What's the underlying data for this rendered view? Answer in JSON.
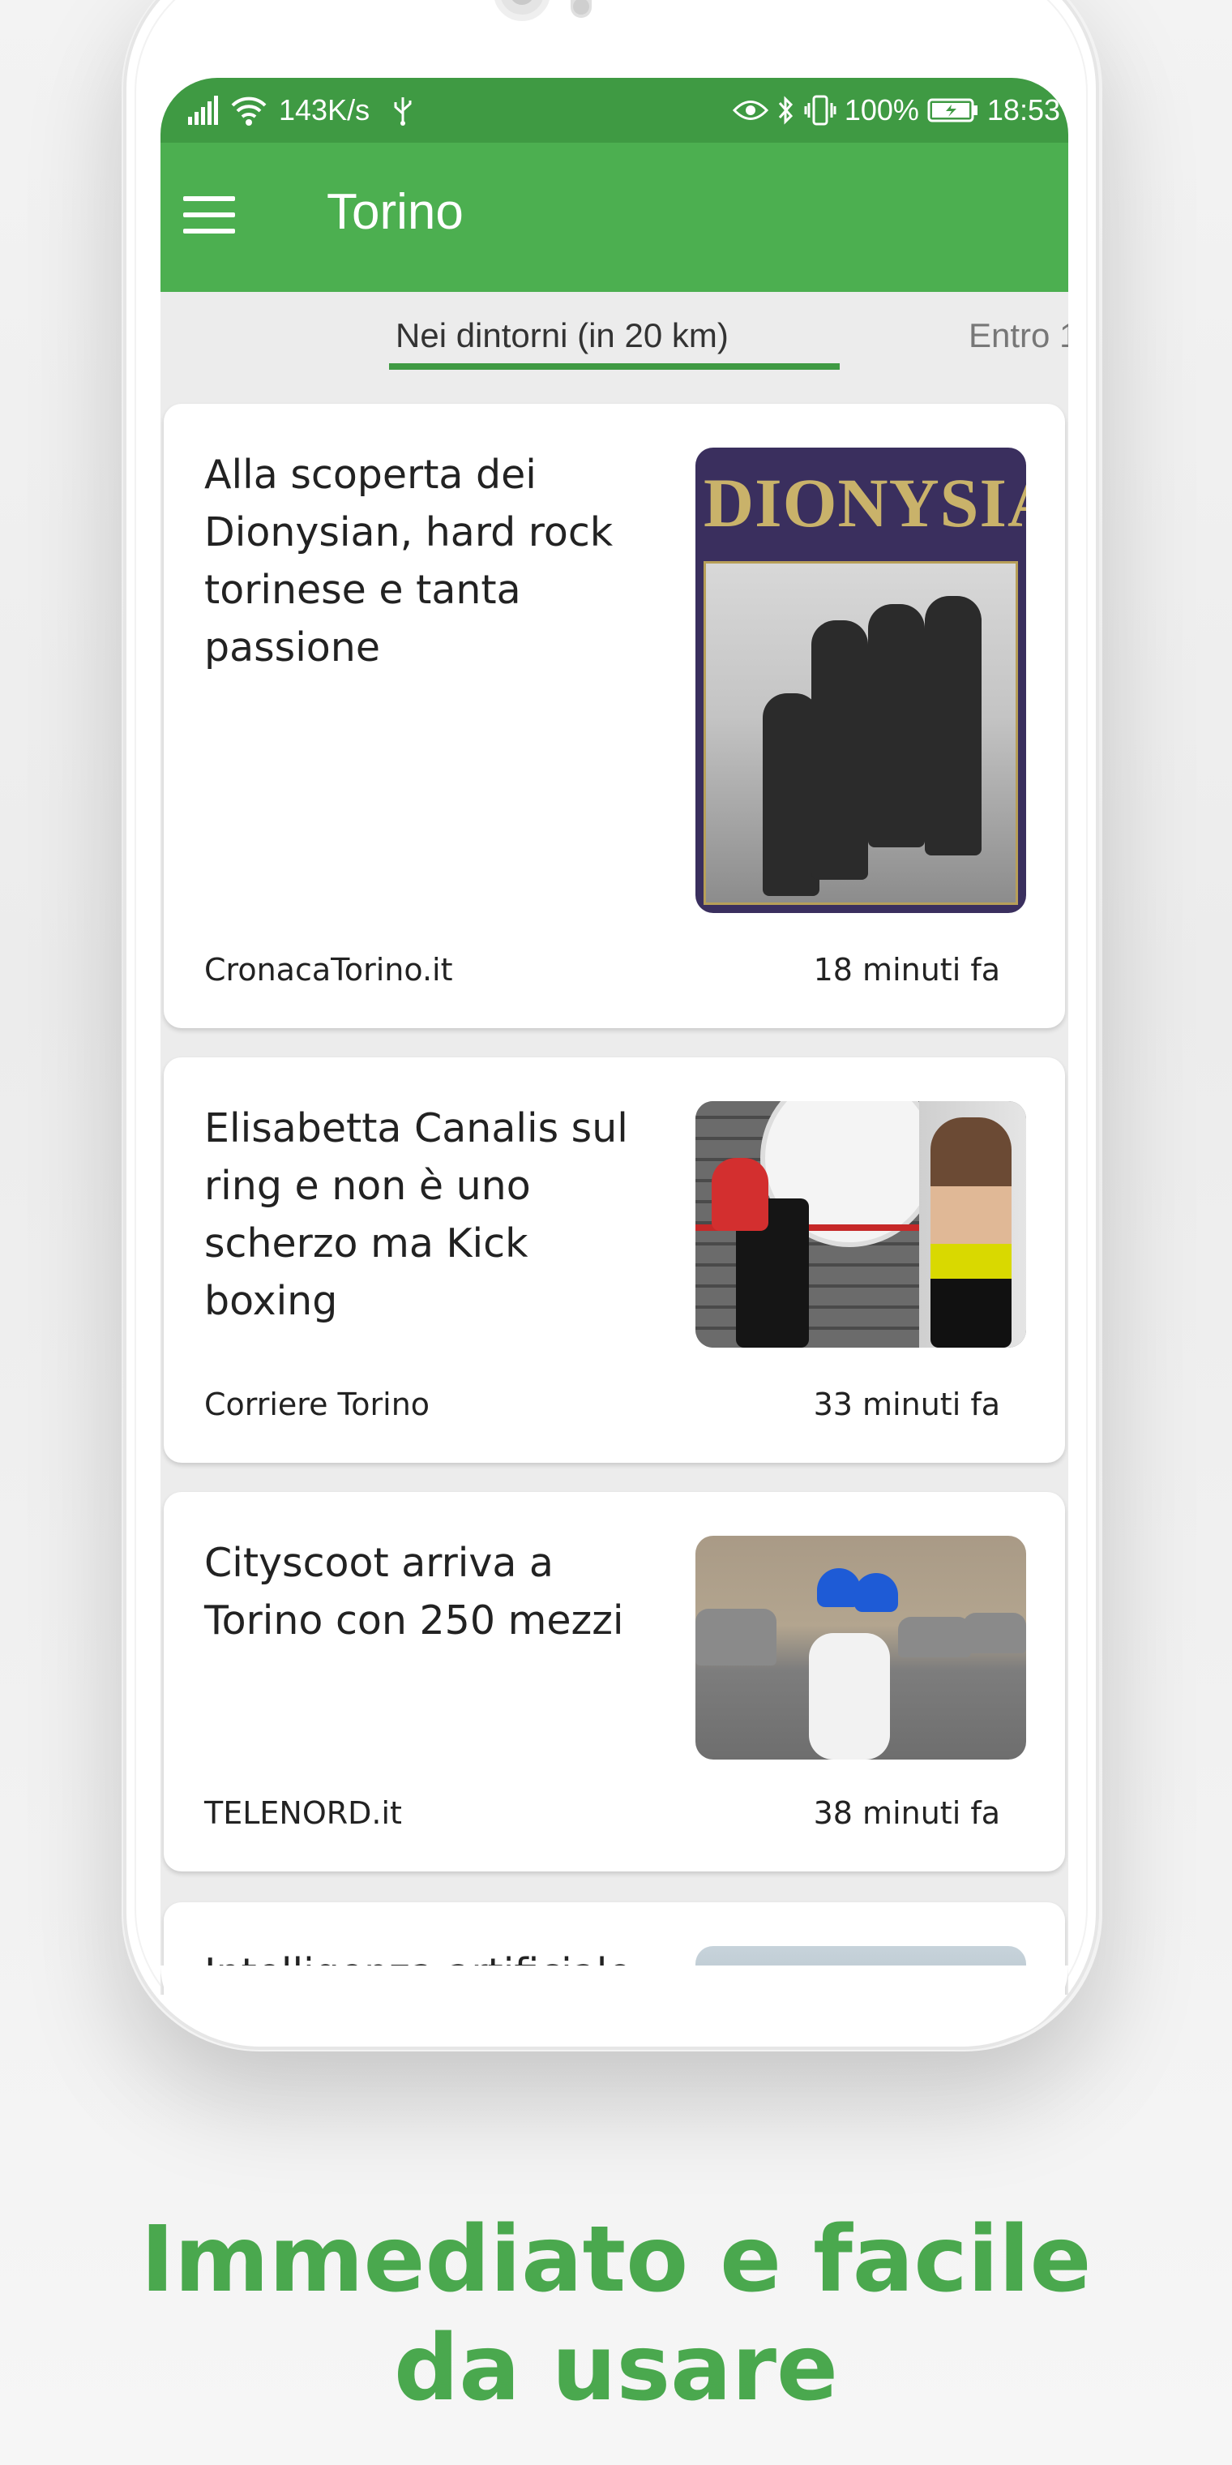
{
  "status_bar": {
    "net_speed": "143K/s",
    "battery": "100%",
    "time": "18:53",
    "icons": [
      "signal-icon",
      "wifi-icon",
      "usb-icon",
      "eye-icon",
      "bluetooth-icon",
      "vibrate-icon",
      "battery-icon"
    ]
  },
  "app_bar": {
    "title": "Torino",
    "menu_icon": "hamburger-menu-icon"
  },
  "tabs": [
    {
      "label": "Nei dintorni (in 20 km)",
      "active": true
    },
    {
      "label": "Entro 1",
      "active": false
    }
  ],
  "articles": [
    {
      "title": "Alla scoperta dei Dionysian, hard rock torinese e tanta passione",
      "source": "CronacaTorino.it",
      "time": "18 minuti fa",
      "image_text": "DIONYSIAN"
    },
    {
      "title": "Elisabetta Canalis sul ring e non è uno scherzo ma Kick boxing",
      "source": "Corriere Torino",
      "time": "33 minuti fa"
    },
    {
      "title": "Cityscoot arriva a Torino con 250 mezzi",
      "source": "TELENORD.it",
      "time": "38 minuti fa"
    },
    {
      "title": "Intelligenza artificiale"
    }
  ],
  "caption": {
    "line1": "Immediato e facile",
    "line2": "da usare"
  },
  "colors": {
    "primary": "#4caf50",
    "primary_dark": "#3f9a43",
    "caption": "#4aa84e"
  }
}
